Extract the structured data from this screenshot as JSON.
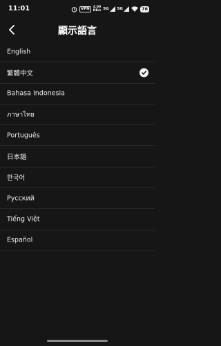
{
  "status_bar": {
    "time": "11:01",
    "vpn_label": "VPN",
    "speed_top": "4.00",
    "speed_bottom": "KB/s",
    "network_1": "5G",
    "network_2": "5G",
    "battery": "76"
  },
  "header": {
    "title": "顯示語言",
    "back_icon": "chevron-left-icon"
  },
  "languages": [
    {
      "label": "English",
      "selected": false
    },
    {
      "label": "繁體中文",
      "selected": true
    },
    {
      "label": "Bahasa Indonesia",
      "selected": false
    },
    {
      "label": "ภาษาไทย",
      "selected": false
    },
    {
      "label": "Português",
      "selected": false
    },
    {
      "label": "日本語",
      "selected": false
    },
    {
      "label": "한국어",
      "selected": false
    },
    {
      "label": "Русский",
      "selected": false
    },
    {
      "label": "Tiếng Việt",
      "selected": false
    },
    {
      "label": "Español",
      "selected": false
    }
  ],
  "colors": {
    "background": "#161616",
    "text": "#ffffff",
    "divider": "#2b2b2b"
  }
}
